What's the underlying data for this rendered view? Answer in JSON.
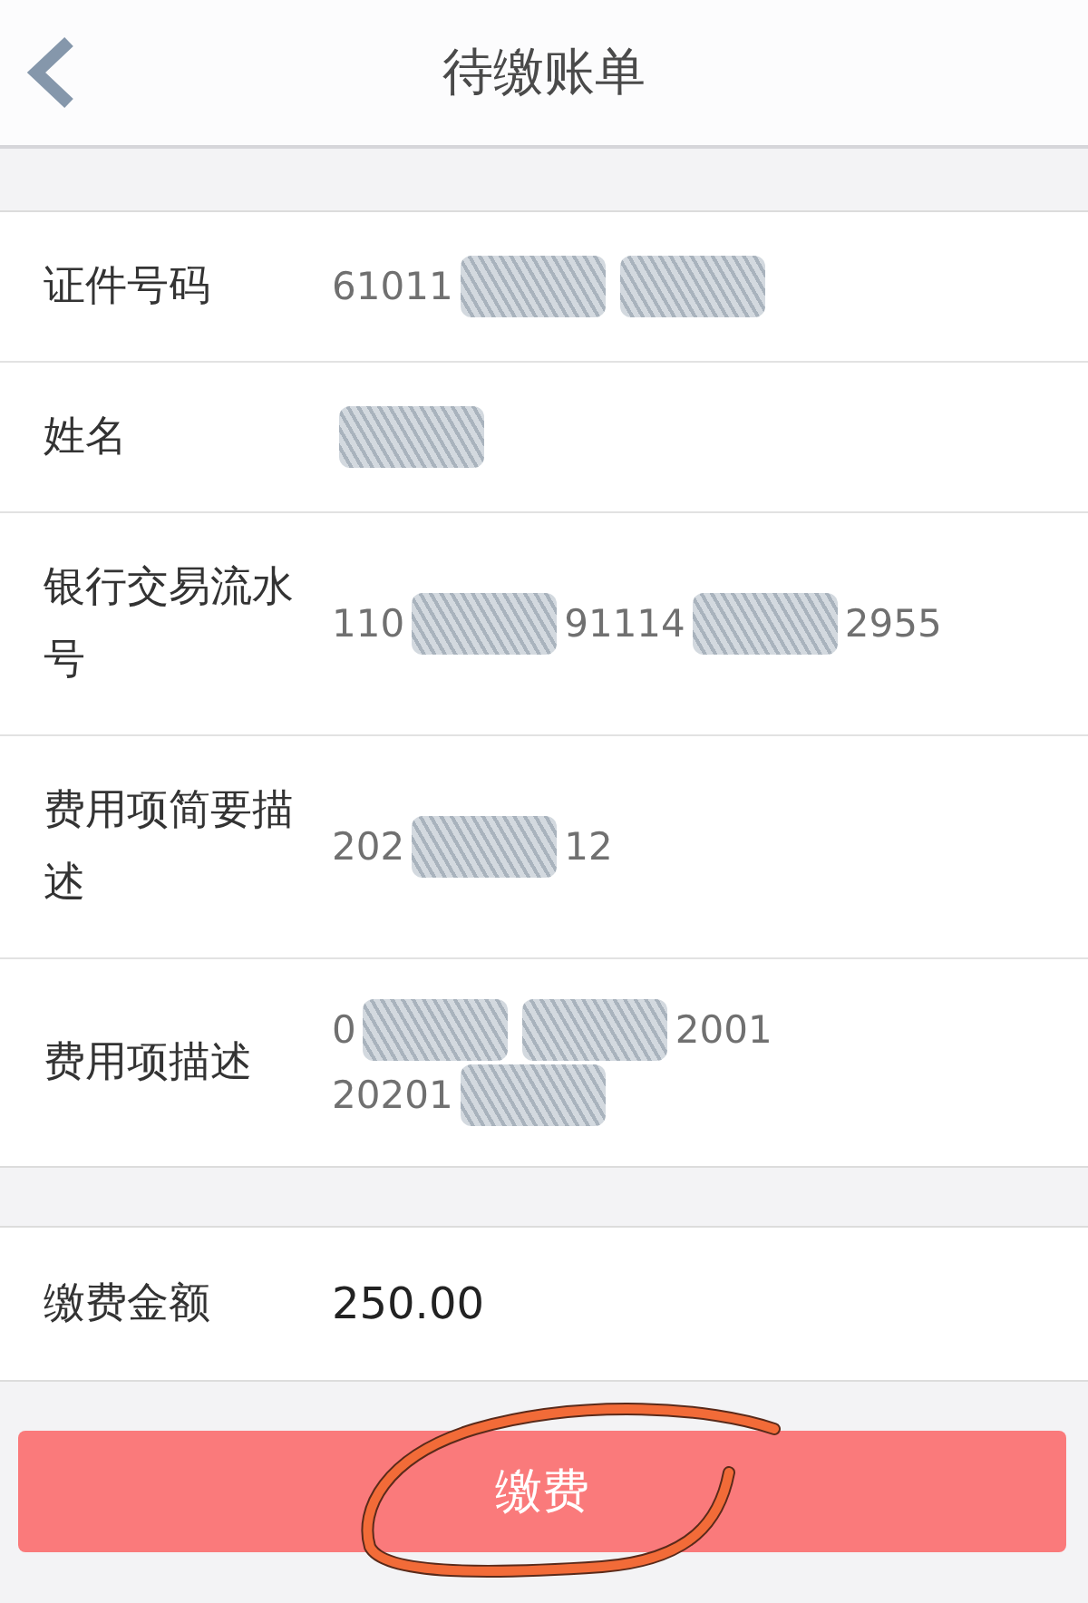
{
  "header": {
    "title": "待缴账单"
  },
  "details": [
    {
      "label": "证件号码",
      "value": [
        [
          {
            "kind": "text",
            "text": "61011"
          },
          {
            "kind": "redacted"
          },
          {
            "kind": "redacted"
          }
        ]
      ]
    },
    {
      "label": "姓名",
      "value": [
        [
          {
            "kind": "redacted"
          }
        ]
      ]
    },
    {
      "label": "银行交易流水号",
      "value": [
        [
          {
            "kind": "text",
            "text": "110"
          },
          {
            "kind": "redacted"
          },
          {
            "kind": "text",
            "text": "91114"
          },
          {
            "kind": "redacted"
          },
          {
            "kind": "text",
            "text": "2955"
          }
        ]
      ]
    },
    {
      "label": "费用项简要描述",
      "value": [
        [
          {
            "kind": "text",
            "text": "202"
          },
          {
            "kind": "redacted"
          },
          {
            "kind": "text",
            "text": "12"
          }
        ]
      ]
    },
    {
      "label": "费用项描述",
      "value": [
        [
          {
            "kind": "text",
            "text": "0"
          },
          {
            "kind": "redacted"
          },
          {
            "kind": "redacted"
          },
          {
            "kind": "text",
            "text": "2001"
          }
        ],
        [
          {
            "kind": "text",
            "text": "20201"
          },
          {
            "kind": "redacted"
          }
        ]
      ]
    }
  ],
  "amount": {
    "label": "缴费金额",
    "value": "250.00"
  },
  "pay_button": {
    "label": "缴费",
    "circled": true
  }
}
